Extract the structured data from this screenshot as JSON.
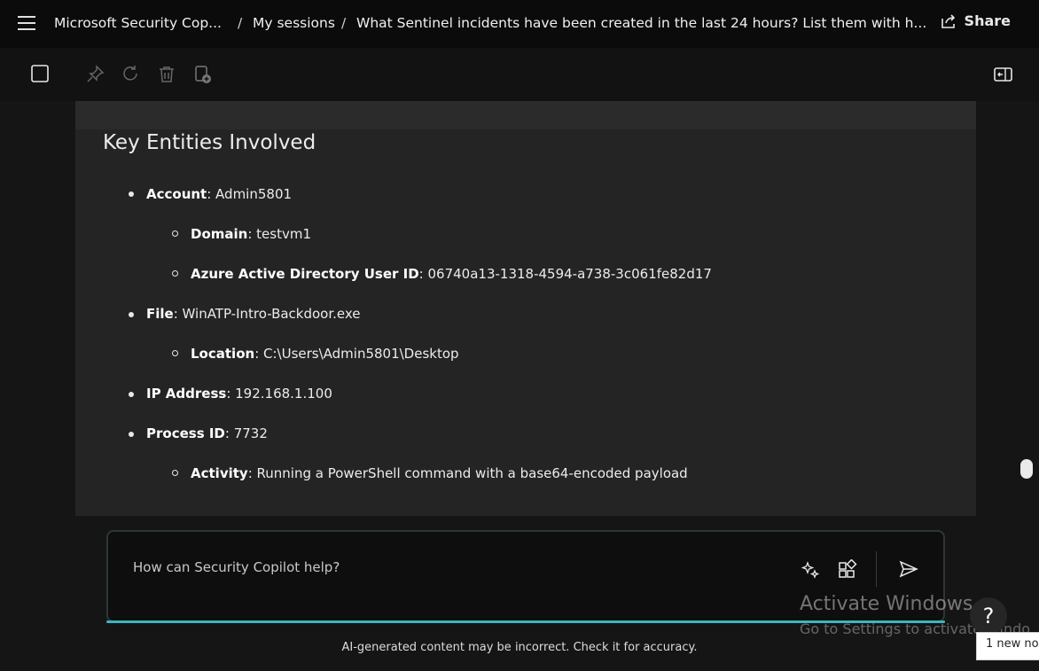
{
  "topbar": {
    "app_title": "Microsoft Security Cop...",
    "sep1": "/",
    "breadcrumb_sessions": "My sessions",
    "sep2": "/",
    "session_title": "What Sentinel incidents have been created in the last 24 hours? List them with h...",
    "share_label": "Share"
  },
  "toolbar": {
    "icons": [
      "checkbox-icon",
      "pin-icon",
      "refresh-icon",
      "delete-icon",
      "add-to-pinboard-icon",
      "side-panel-icon"
    ]
  },
  "response": {
    "heading": "Key Entities Involved",
    "items": [
      {
        "level": 1,
        "label": "Account",
        "value": ": Admin5801"
      },
      {
        "level": 2,
        "label": "Domain",
        "value": ": testvm1"
      },
      {
        "level": 2,
        "label": "Azure Active Directory User ID",
        "value": ": 06740a13-1318-4594-a738-3c061fe82d17"
      },
      {
        "level": 1,
        "label": "File",
        "value": ": WinATP-Intro-Backdoor.exe"
      },
      {
        "level": 2,
        "label": "Location",
        "value": ": C:\\Users\\Admin5801\\Desktop"
      },
      {
        "level": 1,
        "label": "IP Address",
        "value": ": 192.168.1.100"
      },
      {
        "level": 1,
        "label": "Process ID",
        "value": ": 7732"
      },
      {
        "level": 2,
        "label": "Activity",
        "value": ": Running a PowerShell command with a base64-encoded payload"
      }
    ]
  },
  "composer": {
    "placeholder": "How can Security Copilot help?",
    "prompt_icons": [
      "sparkle-prompts-icon",
      "plugins-icon",
      "send-icon"
    ]
  },
  "disclaimer": "AI-generated content may be incorrect. Check it for accuracy.",
  "watermark": {
    "line1": "Activate Windows",
    "line2": "Go to Settings to activate Windo"
  },
  "help": {
    "symbol": "?",
    "toast": "1 new no"
  },
  "colors": {
    "accent": "#3fb4bf",
    "background": "#151515",
    "card": "#242424"
  }
}
